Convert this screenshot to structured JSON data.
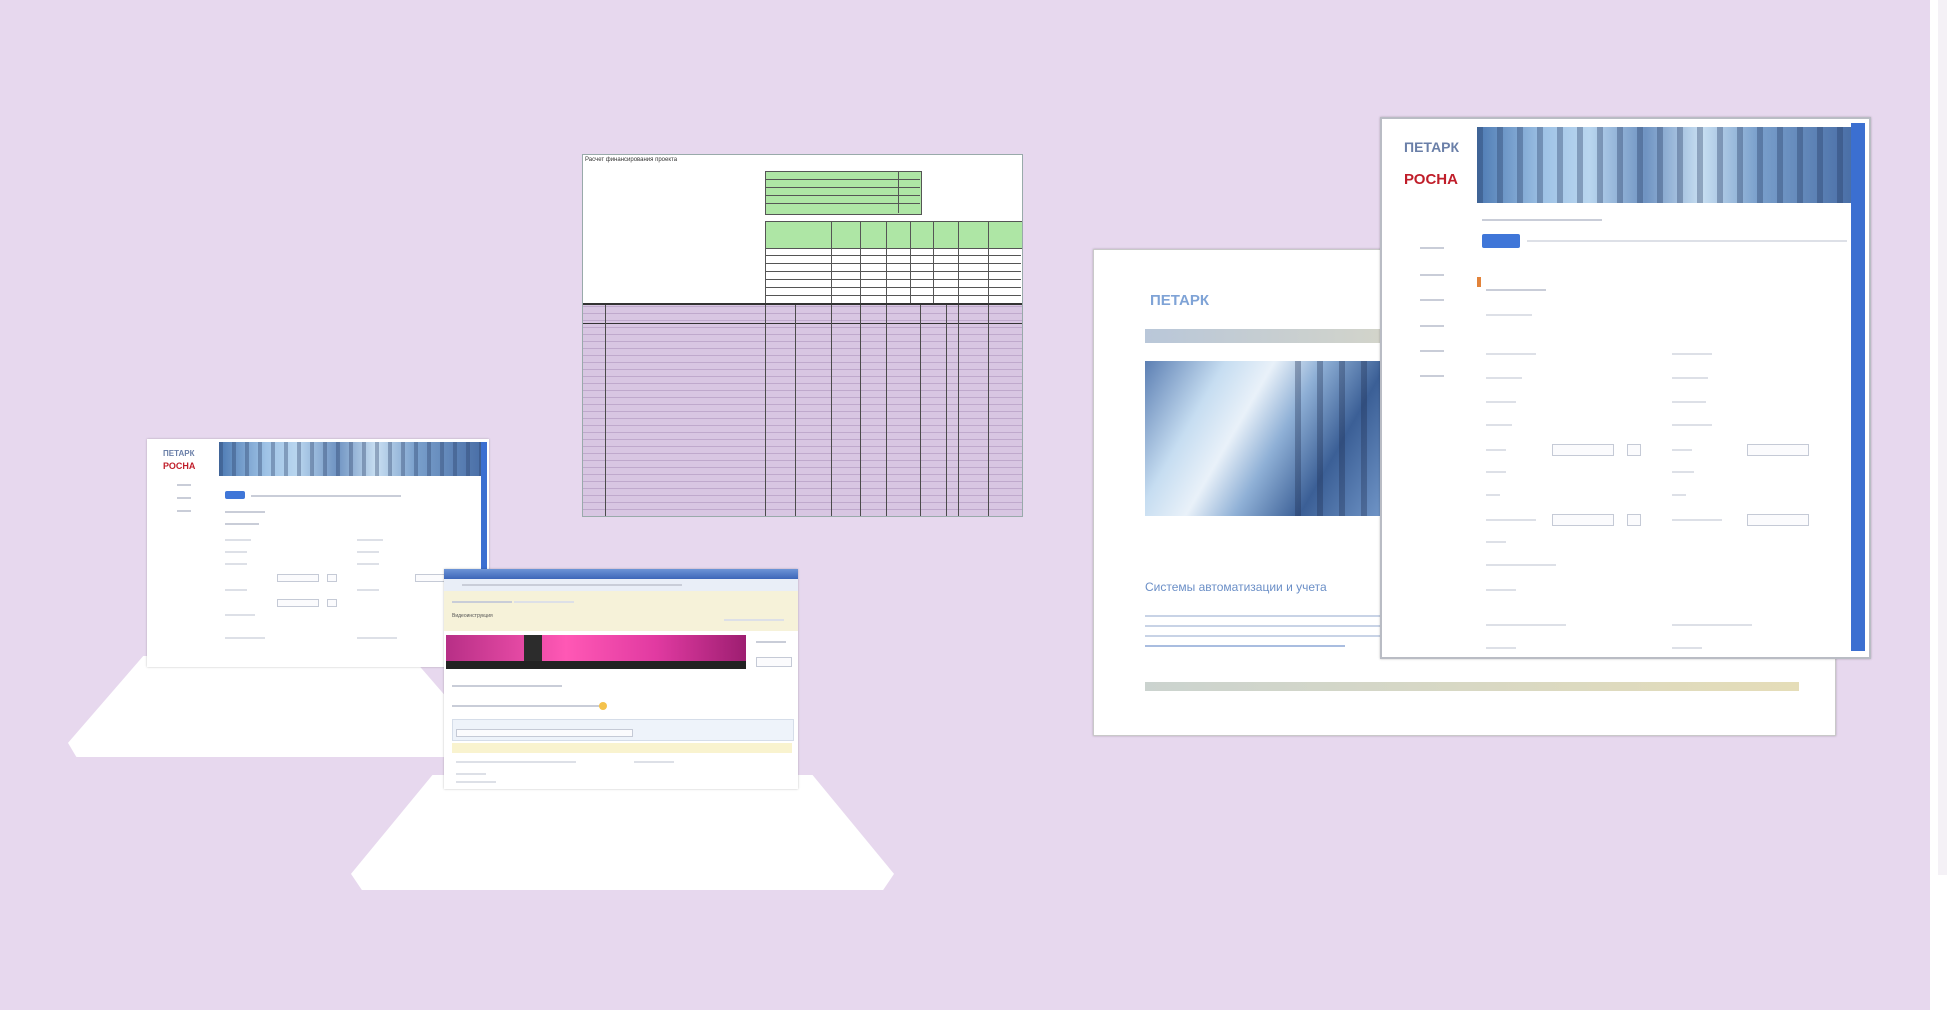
{
  "screenshots": {
    "laptop_left": {
      "logo_text": "ПЕТАРК",
      "logo_brand": "РОСНА"
    },
    "spreadsheet": {
      "title": "Расчет финансирования проекта"
    },
    "video_panel": {
      "caption": "Видеоинструкция"
    },
    "document": {
      "logo_text": "ПЕТАРК",
      "heading": "Системы автоматизации и учета"
    },
    "app_window": {
      "logo_text": "ПЕТАРК",
      "logo_brand": "РОСНА"
    }
  },
  "colors": {
    "background": "#e7d8ee",
    "accent_blue": "#3b6fd1",
    "spreadsheet_green": "#aee6a5",
    "spreadsheet_purple": "#d8c6e2",
    "video_pink": "#ff58b5"
  }
}
